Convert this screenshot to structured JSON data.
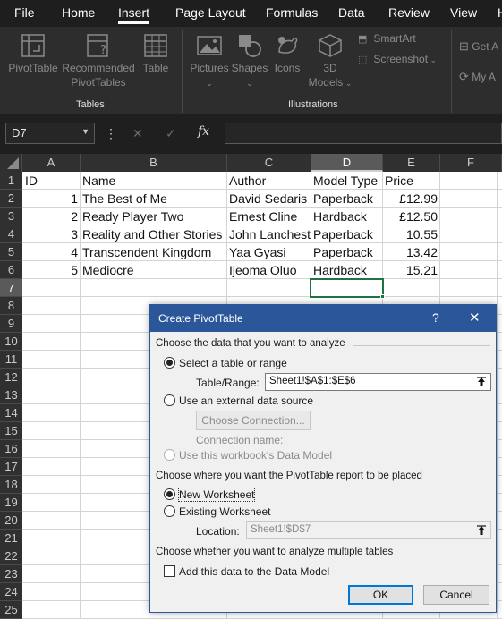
{
  "menu": {
    "tabs": [
      "File",
      "Home",
      "Insert",
      "Page Layout",
      "Formulas",
      "Data",
      "Review",
      "View",
      "H"
    ],
    "active": "Insert"
  },
  "ribbon": {
    "tables": {
      "label": "Tables",
      "pivottable": "PivotTable",
      "recommended_line1": "Recommended",
      "recommended_line2": "PivotTables",
      "table": "Table"
    },
    "illustrations": {
      "label": "Illustrations",
      "pictures": "Pictures",
      "shapes": "Shapes",
      "icons": "Icons",
      "models_line1": "3D",
      "models_line2": "Models",
      "smartart": "SmartArt",
      "screenshot": "Screenshot"
    },
    "addins": {
      "get": "Get A",
      "my": "My A"
    }
  },
  "formula_bar": {
    "name_box": "D7",
    "more_symbol": "⋮",
    "cancel_symbol": "✕",
    "enter_symbol": "✓",
    "fx_symbol": "fx",
    "value": ""
  },
  "sheet": {
    "columns": [
      "A",
      "B",
      "C",
      "D",
      "E",
      "F"
    ],
    "selected_column": "D",
    "rows": [
      "1",
      "2",
      "3",
      "4",
      "5",
      "6",
      "7",
      "8",
      "9",
      "10",
      "11",
      "12",
      "13",
      "14",
      "15",
      "16",
      "17",
      "18",
      "19",
      "20",
      "21",
      "22",
      "23",
      "24",
      "25"
    ],
    "selected_row": "7",
    "header": [
      "ID",
      "Name",
      "Author",
      "Model Type",
      "Price"
    ],
    "data": [
      [
        "1",
        "The Best of Me",
        "David Sedaris",
        "Paperback",
        "£12.99"
      ],
      [
        "2",
        "Ready Player Two",
        "Ernest Cline",
        "Hardback",
        "£12.50"
      ],
      [
        "3",
        "Reality and Other Stories",
        "John Lanchest",
        "Paperback",
        "10.55"
      ],
      [
        "4",
        "Transcendent Kingdom",
        "Yaa Gyasi",
        "Paperback",
        "13.42"
      ],
      [
        "5",
        "Mediocre",
        "Ijeoma Oluo",
        "Hardback",
        "15.21"
      ]
    ]
  },
  "dialog": {
    "title": "Create PivotTable",
    "help": "?",
    "close": "✕",
    "section1": "Choose the data that you want to analyze",
    "opt_select_range": "Select a table or range",
    "table_range_label": "Table/Range:",
    "table_range_value": "Sheet1!$A$1:$E$6",
    "opt_external": "Use an external data source",
    "choose_connection": "Choose Connection...",
    "connection_name_label": "Connection name:",
    "opt_data_model": "Use this workbook's Data Model",
    "section2": "Choose where you want the PivotTable report to be placed",
    "opt_new_ws": "New Worksheet",
    "opt_existing_ws": "Existing Worksheet",
    "location_label": "Location:",
    "location_value": "Sheet1!$D$7",
    "section3": "Choose whether you want to analyze multiple tables",
    "add_to_model": "Add this data to the Data Model",
    "ok": "OK",
    "cancel": "Cancel"
  }
}
